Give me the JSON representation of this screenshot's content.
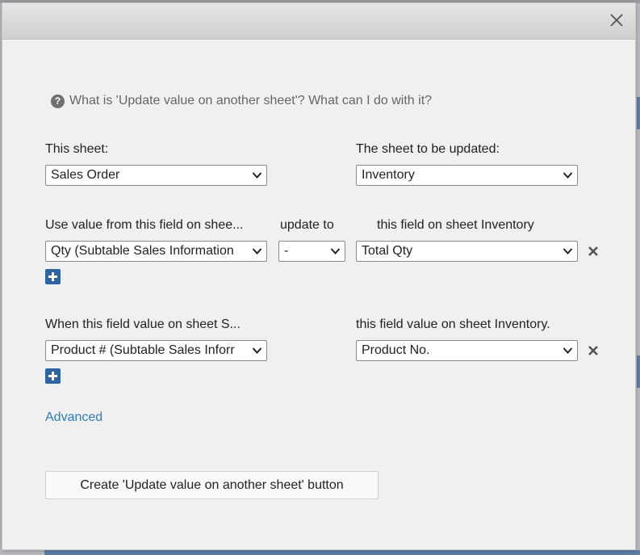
{
  "dialog": {
    "help_text": "What is 'Update value on another sheet'? What can I do with it?",
    "help_icon": "question-circle-icon",
    "close_icon": "close-icon"
  },
  "sheets": {
    "this_label": "This sheet:",
    "this_value": "Sales Order",
    "target_label": "The sheet to be updated:",
    "target_value": "Inventory"
  },
  "update": {
    "source_label": "Use value from this field on shee...",
    "operator_label": "update to",
    "target_label": "this field on sheet Inventory",
    "source_value": "Qty (Subtable Sales Information",
    "operator_value": "-",
    "target_value": "Total Qty"
  },
  "match": {
    "source_label": "When this field value on sheet S...",
    "target_label": "this field value on sheet Inventory.",
    "source_value": "Product # (Subtable Sales Inforr",
    "target_value": "Product No."
  },
  "advanced_label": "Advanced",
  "create_button_label": "Create 'Update value on another sheet' button",
  "colors": {
    "accent_blue": "#2f64a4",
    "link_blue": "#2e7bbf",
    "dialog_bg": "#f0f0f0"
  }
}
